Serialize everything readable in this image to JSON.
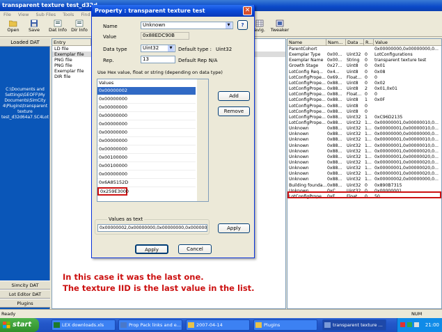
{
  "window": {
    "title": "transparent texture test_d32d"
  },
  "menu": [
    "File",
    "View",
    "Sub Files",
    "Tools",
    "Find",
    "Op"
  ],
  "toolbar": {
    "open": "Open",
    "save": "Save",
    "dat_info": "Dat Info",
    "dir_info": "Dir Info",
    "navig": "avig.",
    "tweaker": "Tweaker"
  },
  "left_panel": {
    "header": "Loaded DAT",
    "path": "C:\\Documents and Settings\\GEOFF\\My Documents\\SimCity 4\\Plugins\\transparent texture test_d32d64a7.SC4Lot",
    "tabs": [
      "Simcity DAT",
      "Lot Editor DAT",
      "Plugins"
    ]
  },
  "entries": {
    "header": "Entry",
    "items": [
      "LD file",
      "Exemplar file",
      "PNG file",
      "PNG file",
      "Exemplar file",
      "DIR file"
    ]
  },
  "grid": {
    "headers": [
      "Name",
      "Nam...",
      "Data ...",
      "R...",
      "Value"
    ],
    "rows": [
      [
        "ParentCohort",
        "",
        "",
        "",
        "0x00000000,0x00000000,0..."
      ],
      [
        "Exemplar Type",
        "0x00...",
        "Uint32",
        "0",
        "LotConfigurations"
      ],
      [
        "Exemplar Name",
        "0x00...",
        "String",
        "0",
        "transparent texture test"
      ],
      [
        "Growth Stage",
        "0x27...",
        "Uint8",
        "0",
        "0x01"
      ],
      [
        "LotConfig Req...",
        "0x4...",
        "Uint8",
        "0",
        "0x08"
      ],
      [
        "LotConfigPrope...",
        "0x69...",
        "Float...",
        "0",
        "0"
      ],
      [
        "LotConfigPrope...",
        "0x88...",
        "Uint8",
        "0",
        "0x02"
      ],
      [
        "LotConfigPrope...",
        "0x88...",
        "Uint8",
        "2",
        "0x01,0x01"
      ],
      [
        "LotConfigPrope...",
        "0x88...",
        "Float...",
        "0",
        "0"
      ],
      [
        "LotConfigPrope...",
        "0x88...",
        "Uint8",
        "1",
        "0x0F"
      ],
      [
        "LotConfigPrope...",
        "0x88...",
        "Uint8",
        "0",
        ""
      ],
      [
        "LotConfigPrope...",
        "0x88...",
        "Uint8",
        "0",
        ""
      ],
      [
        "LotConfigPrope...",
        "0x88...",
        "Uint32",
        "1",
        "0xC96D2135"
      ],
      [
        "LotConfigPrope...",
        "0x88...",
        "Uint32",
        "1...",
        "0x00000001,0x00000010,0..."
      ],
      [
        "Unknown",
        "0x88...",
        "Uint32",
        "1...",
        "0x00000001,0x00000010,0..."
      ],
      [
        "Unknown",
        "0x88...",
        "Uint32",
        "1...",
        "0x00000000,0x00000000,0..."
      ],
      [
        "Unknown",
        "0x88...",
        "Uint32",
        "1...",
        "0x00000001,0x00000010,0..."
      ],
      [
        "Unknown",
        "0x88...",
        "Uint32",
        "1...",
        "0x00000001,0x00000010,0..."
      ],
      [
        "Unknown",
        "0x88...",
        "Uint32",
        "1...",
        "0x00000001,0x00000020,0..."
      ],
      [
        "Unknown",
        "0x88...",
        "Uint32",
        "1...",
        "0x00000001,0x00000020,0..."
      ],
      [
        "Unknown",
        "0x88...",
        "Uint32",
        "1...",
        "0x00000001,0x00000020,0..."
      ],
      [
        "Unknown",
        "0x88...",
        "Uint32",
        "1...",
        "0x00000001,0x00000020,0..."
      ],
      [
        "Unknown",
        "0x88...",
        "Uint32",
        "1...",
        "0x00000001,0x00000020,0..."
      ],
      [
        "Unknown",
        "0x88...",
        "Uint32",
        "1...",
        "0x00000002,0x00000000,0..."
      ],
      [
        "Building founda...",
        "0x88...",
        "Uint32",
        "0",
        "0x890B7315"
      ],
      [
        "Unknown",
        "0xC...",
        "Uint32",
        "0",
        "0x00000001"
      ],
      [
        "LotConfigPrope...",
        "0xE...",
        "Float...",
        "0",
        "50"
      ]
    ]
  },
  "dialog": {
    "title": "Property : transparent texture test",
    "name_label": "Name",
    "name_value": "Unknown",
    "help": "?",
    "value_label": "Value",
    "value_value": "0x88EDC90B",
    "data_type_label": "Data type",
    "data_type_value": "Uint32",
    "default_type_label": "Default type :",
    "default_type_value": "Uint32",
    "rep_label": "Rep.",
    "rep_value": "13",
    "default_rep_label": "Default Rep :",
    "default_rep_value": "N/A",
    "hint": "Use Hex value, float or string (depending on data type)",
    "values_header": "Values",
    "values": [
      "0x00000002",
      "0x00000000",
      "0x00000000",
      "0x00000000",
      "0x00000000",
      "0x00000000",
      "0x00000000",
      "0x00000000",
      "0x00100000",
      "0x00100000",
      "0x00000000",
      "0x6A85152D",
      "0x259E3000"
    ],
    "add": "Add",
    "remove": "Remove",
    "values_as_text_label": "Values as text",
    "values_as_text": "0x00000002,0x00000000,0x00000000,0x00000000,0x0...",
    "apply_small": "Apply",
    "apply": "Apply",
    "cancel": "Cancel"
  },
  "overlay": {
    "line1": "In this case it was the last one.",
    "line2": "The texture IID is the last value in the list."
  },
  "status": {
    "text": "Ready",
    "num": "NUM"
  },
  "taskbar": {
    "start": "start",
    "tasks": [
      "LEX downloads.xls",
      "Prop Pack links and e...",
      "2007-04-14",
      "Plugins",
      "transparent texture ..."
    ],
    "clock": "21:00"
  },
  "colors": {
    "highlight_red": "#cc1111",
    "selection_blue": "#316ac5",
    "panel_blue": "#0a56b8"
  }
}
